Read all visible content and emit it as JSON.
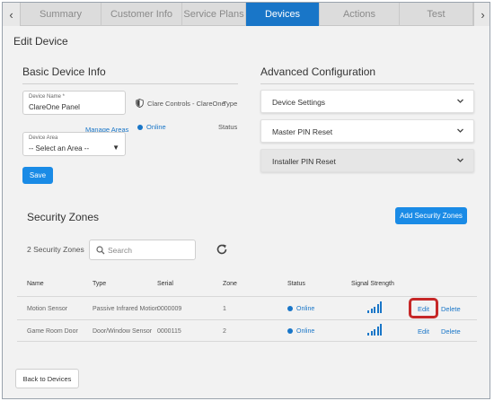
{
  "tabs": {
    "prev_icon": "chevron-left-icon",
    "next_icon": "chevron-right-icon",
    "prev_glyph": "‹",
    "next_glyph": "›",
    "items": [
      "Summary",
      "Customer Info",
      "Service Plans",
      "Devices",
      "Actions",
      "Test"
    ],
    "active": "Devices"
  },
  "page_title": "Edit Device",
  "basic": {
    "title": "Basic Device Info",
    "device_name_label": "Device Name *",
    "device_name_value": "ClareOne Panel",
    "brand": "Clare Controls - ClareOne",
    "brand_icon": "shield-icon",
    "type_label": "Type",
    "manage_areas": "Manage Areas",
    "status_value": "Online",
    "status_label": "Status",
    "device_area_label": "Device Area",
    "device_area_value": "-- Select an Area --",
    "save_label": "Save"
  },
  "advanced": {
    "title": "Advanced Configuration",
    "items": [
      "Device Settings",
      "Master PIN Reset",
      "Installer PIN Reset"
    ]
  },
  "zones": {
    "title": "Security Zones",
    "add_label": "Add Security Zones",
    "count_label": "2 Security Zones",
    "search_placeholder": "Search",
    "refresh_icon": "refresh-icon",
    "columns": [
      "Name",
      "Type",
      "Serial",
      "Zone",
      "Status",
      "Signal Strength"
    ],
    "rows": [
      {
        "name": "Motion Sensor",
        "type": "Passive Infrared Motion",
        "serial": "0000009",
        "zone": "1",
        "status": "Online",
        "signal": 5,
        "edit": "Edit",
        "delete": "Delete"
      },
      {
        "name": "Game Room Door",
        "type": "Door/Window Sensor",
        "serial": "0000115",
        "zone": "2",
        "status": "Online",
        "signal": 5,
        "edit": "Edit",
        "delete": "Delete"
      }
    ]
  },
  "back_label": "Back to Devices",
  "colors": {
    "accent": "#1976c8",
    "button": "#1a8be6",
    "highlight": "#c62828"
  }
}
